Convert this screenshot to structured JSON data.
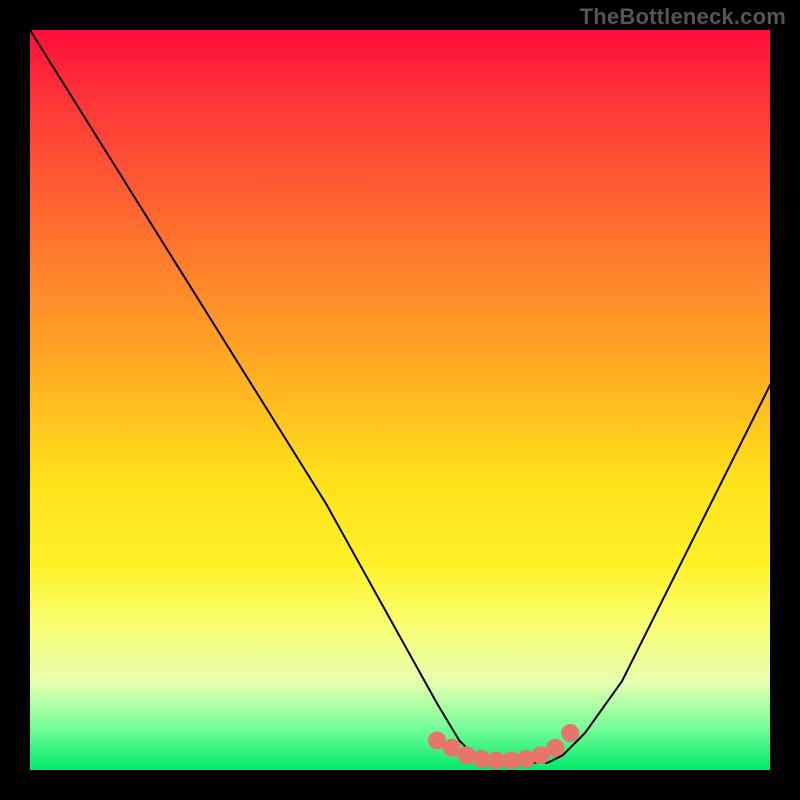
{
  "watermark": "TheBottleneck.com",
  "chart_data": {
    "type": "line",
    "title": "",
    "xlabel": "",
    "ylabel": "",
    "xlim": [
      0,
      100
    ],
    "ylim": [
      0,
      100
    ],
    "series": [
      {
        "name": "bottleneck-curve",
        "x": [
          0,
          5,
          10,
          15,
          20,
          25,
          30,
          35,
          40,
          45,
          50,
          55,
          58,
          60,
          63,
          66,
          70,
          72,
          75,
          80,
          85,
          90,
          95,
          100
        ],
        "y": [
          100,
          92,
          84,
          76,
          68,
          60,
          52,
          44,
          36,
          27,
          18,
          9,
          4,
          2,
          1,
          1,
          1,
          2,
          5,
          12,
          22,
          32,
          42,
          52
        ],
        "color": "#000000"
      },
      {
        "name": "optimal-zone",
        "type": "scatter",
        "x": [
          55,
          57,
          59,
          61,
          63,
          65,
          67,
          69,
          71,
          73
        ],
        "y": [
          4,
          3,
          2,
          1.5,
          1.3,
          1.3,
          1.5,
          2,
          3,
          5
        ],
        "color": "#e8756b"
      }
    ],
    "gradient_stops": [
      {
        "pos": 0,
        "color": "#ff0d3a"
      },
      {
        "pos": 8,
        "color": "#ff3038"
      },
      {
        "pos": 20,
        "color": "#ff5733"
      },
      {
        "pos": 35,
        "color": "#ff8a2a"
      },
      {
        "pos": 48,
        "color": "#ffb321"
      },
      {
        "pos": 60,
        "color": "#ffe01a"
      },
      {
        "pos": 72,
        "color": "#fff126"
      },
      {
        "pos": 80,
        "color": "#faff6e"
      },
      {
        "pos": 88,
        "color": "#e7ffb0"
      },
      {
        "pos": 94,
        "color": "#7cff9a"
      },
      {
        "pos": 100,
        "color": "#00e96b"
      }
    ]
  }
}
